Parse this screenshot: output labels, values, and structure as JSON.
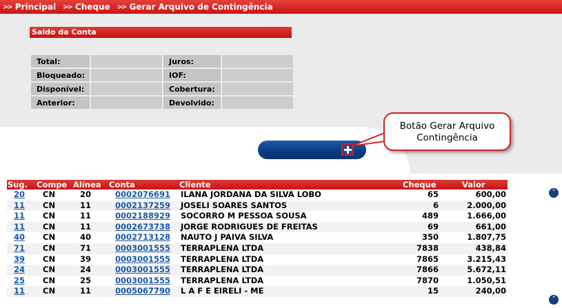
{
  "breadcrumb": [
    {
      "sep": ">>",
      "label": "Principal"
    },
    {
      "sep": ">>",
      "label": "Cheque"
    },
    {
      "sep": ">>",
      "label": "Gerar Arquivo de Contingência"
    }
  ],
  "saldo": {
    "title": "Saldo da Conta",
    "rows": [
      {
        "l1": "Total:",
        "v1": "",
        "l2": "Juros:",
        "v2": ""
      },
      {
        "l1": "Bloqueado:",
        "v1": "",
        "l2": "IOF:",
        "v2": ""
      },
      {
        "l1": "Disponível:",
        "v1": "",
        "l2": "Cobertura:",
        "v2": ""
      },
      {
        "l1": "Anterior:",
        "v1": "",
        "l2": "Devolvido:",
        "v2": ""
      }
    ]
  },
  "callout": {
    "line1": "Botão Gerar Arquivo",
    "line2": "Contingência"
  },
  "grid": {
    "headers": {
      "sug": "Sug.",
      "compe": "Compe",
      "alinea": "Alínea",
      "conta": "Conta",
      "cliente": "Cliente",
      "cheque": "Cheque",
      "valor": "Valor"
    },
    "rows": [
      {
        "sug": "20",
        "compe": "CN",
        "alinea": "20",
        "conta": "0002076691",
        "cliente": "ILANA JORDANA DA SILVA LOBO",
        "cheque": "65",
        "valor": "600,00"
      },
      {
        "sug": "11",
        "compe": "CN",
        "alinea": "11",
        "conta": "0002137259",
        "cliente": "JOSELI SOARES SANTOS",
        "cheque": "6",
        "valor": "2.000,00"
      },
      {
        "sug": "11",
        "compe": "CN",
        "alinea": "11",
        "conta": "0002188929",
        "cliente": "SOCORRO M PESSOA SOUSA",
        "cheque": "489",
        "valor": "1.666,00"
      },
      {
        "sug": "11",
        "compe": "CN",
        "alinea": "11",
        "conta": "0002673738",
        "cliente": "JORGE RODRIGUES DE FREITAS",
        "cheque": "69",
        "valor": "661,00"
      },
      {
        "sug": "40",
        "compe": "CN",
        "alinea": "40",
        "conta": "0002713128",
        "cliente": "NAUTO J PAIVA SILVA",
        "cheque": "350",
        "valor": "1.807,75"
      },
      {
        "sug": "71",
        "compe": "CN",
        "alinea": "71",
        "conta": "0003001555",
        "cliente": "TERRAPLENA LTDA",
        "cheque": "7838",
        "valor": "438,84"
      },
      {
        "sug": "39",
        "compe": "CN",
        "alinea": "39",
        "conta": "0003001555",
        "cliente": "TERRAPLENA LTDA",
        "cheque": "7865",
        "valor": "3.215,43"
      },
      {
        "sug": "24",
        "compe": "CN",
        "alinea": "24",
        "conta": "0003001555",
        "cliente": "TERRAPLENA LTDA",
        "cheque": "7866",
        "valor": "5.672,11"
      },
      {
        "sug": "25",
        "compe": "CN",
        "alinea": "25",
        "conta": "0003001555",
        "cliente": "TERRAPLENA LTDA",
        "cheque": "7870",
        "valor": "1.050,51"
      },
      {
        "sug": "11",
        "compe": "CN",
        "alinea": "11",
        "conta": "0005067790",
        "cliente": "L A F E EIRELI - ME",
        "cheque": "15",
        "valor": "240,00"
      }
    ]
  },
  "icons": {
    "scroll_up": "double-chevron-up-icon",
    "scroll_down": "double-chevron-down-icon",
    "gerar": "plus-icon"
  },
  "colors": {
    "header_red": "#cc1414",
    "button_blue": "#0a3a80",
    "link_blue": "#1a57a6",
    "panel_grey": "#ebebeb"
  }
}
